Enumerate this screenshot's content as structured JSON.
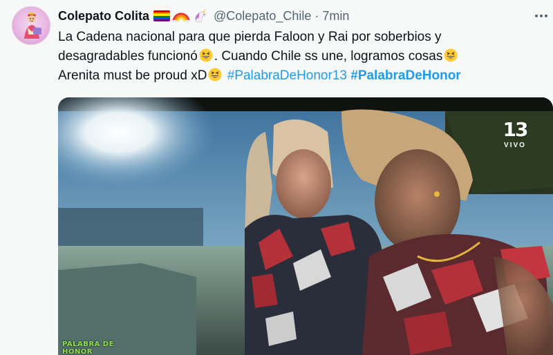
{
  "tweet": {
    "display_name": "Colepato Colita",
    "handle": "@Colepato_Chile",
    "separator": "·",
    "time": "7min",
    "name_emojis": [
      "rainbow-flag-icon",
      "rainbow-icon",
      "unicorn-icon"
    ],
    "text": {
      "line1": "La Cadena nacional para que pierda Faloon y Rai por soberbios y",
      "line2a": "desagradables funcionó",
      "line2b": ". Cuando Chile ss une, logramos cosas",
      "line3a": "Arenita must be proud xD",
      "hashtag1": "#PalabraDeHonor13",
      "hashtag2": "#PalabraDeHonor"
    },
    "emoji_name": "grinning-squinting-face-icon"
  },
  "media": {
    "broadcaster_number": "13",
    "broadcaster_live": "VIVO",
    "show_bug_line1": "PALABRA DE",
    "show_bug_line2": "HONOR"
  },
  "colors": {
    "link": "#1d9bf0",
    "secondary_text": "#536471",
    "background": "#f7f9f9",
    "show_bug": "#8fe34a"
  }
}
